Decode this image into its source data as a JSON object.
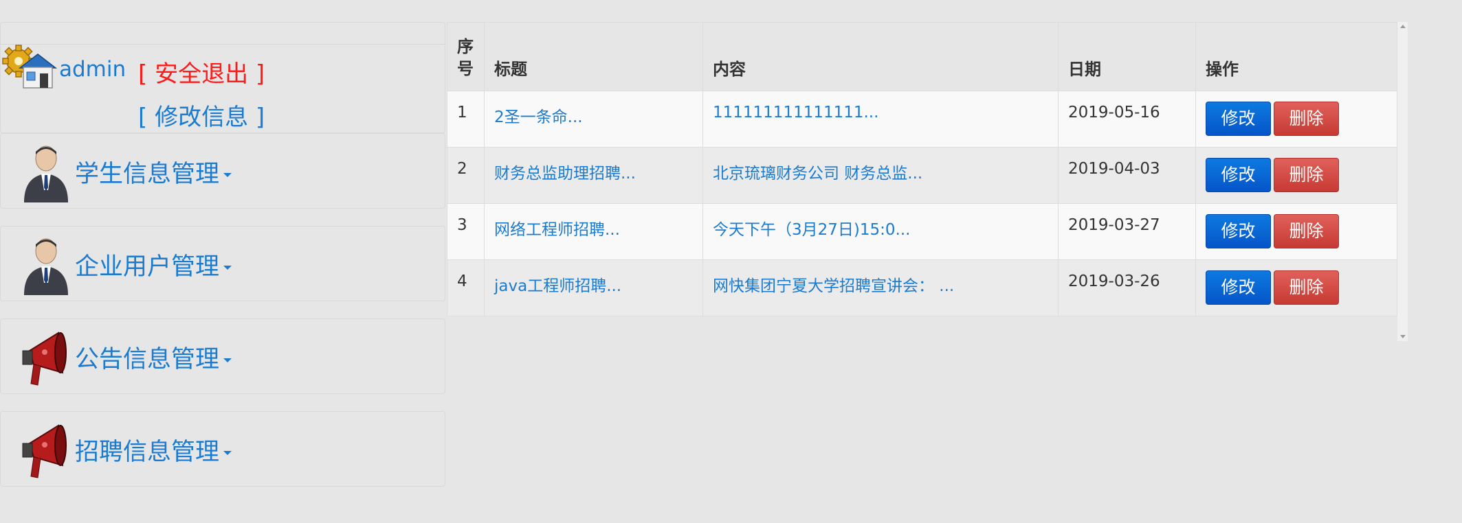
{
  "user": {
    "name": "admin",
    "logout_label": "[ 安全退出 ]",
    "edit_info_label": "[ 修改信息 ]"
  },
  "sidebar": {
    "items": [
      {
        "label": "学生信息管理",
        "icon": "person-icon"
      },
      {
        "label": "企业用户管理",
        "icon": "person-icon"
      },
      {
        "label": "公告信息管理",
        "icon": "megaphone-icon"
      },
      {
        "label": "招聘信息管理",
        "icon": "megaphone-icon"
      }
    ]
  },
  "table": {
    "headers": {
      "seq_line1": "序",
      "seq_line2": "号",
      "title": "标题",
      "content": "内容",
      "date": "日期",
      "ops": "操作"
    },
    "rows": [
      {
        "seq": "1",
        "title": "2圣一条命...",
        "content": "111111111111111...",
        "date": "2019-05-16"
      },
      {
        "seq": "2",
        "title": "财务总监助理招聘...",
        "content": "北京琉璃财务公司 财务总监...",
        "date": "2019-04-03"
      },
      {
        "seq": "3",
        "title": "网络工程师招聘...",
        "content": "今天下午（3月27日)15:0...",
        "date": "2019-03-27"
      },
      {
        "seq": "4",
        "title": "java工程师招聘...",
        "content": "网快集团宁夏大学招聘宣讲会：  ...",
        "date": "2019-03-26"
      }
    ],
    "edit_label": "修改",
    "delete_label": "删除"
  },
  "colors": {
    "link": "#1a7bd0",
    "logout": "#ff1a1a",
    "edit_button": "#0a63d3",
    "delete_button": "#d9534f"
  }
}
